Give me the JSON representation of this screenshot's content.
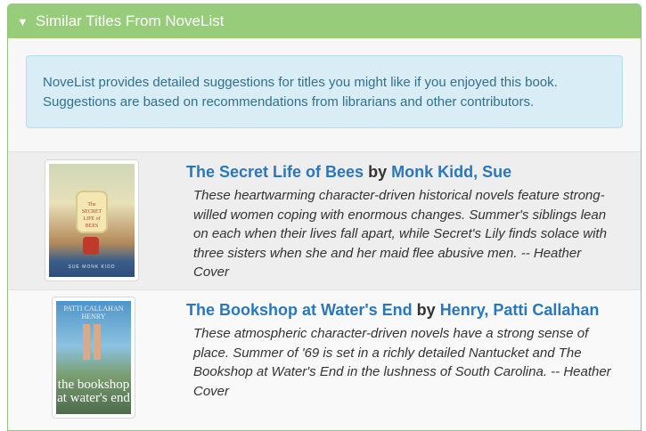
{
  "panel": {
    "header": "Similar Titles From NoveList",
    "info": "NoveList provides detailed suggestions for titles you might like if you enjoyed this book. Suggestions are based on recommendations from librarians and other contributors."
  },
  "books": [
    {
      "title": "The Secret Life of Bees",
      "by": "by",
      "author": "Monk Kidd, Sue",
      "description": "These heartwarming character-driven historical novels feature strong-willed women coping with enormous changes. Summer's siblings lean on each when their lives fall apart, while Secret's Lily finds solace with three sisters when she and her maid flee abusive men. -- Heather Cover",
      "cover_title": "The SECRET LIFE of BEES",
      "cover_author": "SUE MONK KIDD"
    },
    {
      "title": "The Bookshop at Water's End",
      "by": "by",
      "author": "Henry, Patti Callahan",
      "description": "These atmospheric character-driven novels have a strong sense of place. Summer of '69 is set in a richly detailed Nantucket and The Bookshop at Water's End in the lushness of South Carolina. -- Heather Cover",
      "cover_title": "the bookshop at water's end",
      "cover_author": "PATTI CALLAHAN HENRY"
    }
  ]
}
